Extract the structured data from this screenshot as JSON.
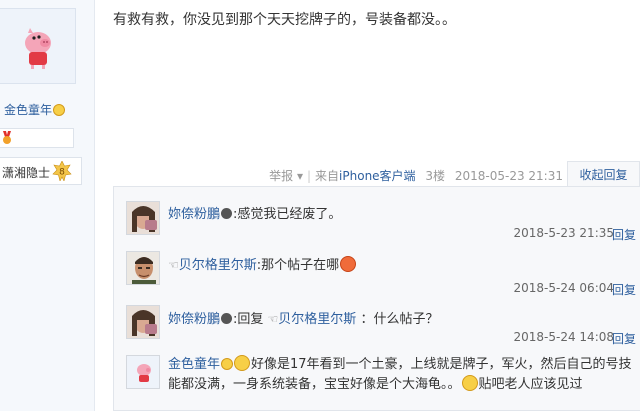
{
  "left": {
    "username": "金色童年",
    "rank_title": "潇湘隐士",
    "level": "8"
  },
  "post": {
    "text": "有救有救，你没见到那个天天挖牌子的，号装备都没。。",
    "meta": {
      "report": "举报",
      "report_arrow": "▾",
      "separator": "|",
      "client_prefix": "来自",
      "client_name": "iPhone客户端",
      "floor": "3楼",
      "datetime": "2018-05-23 21:31",
      "collapse_label": "收起回复"
    }
  },
  "replies": [
    {
      "user": "妳倷粉鵬",
      "text": ":感觉我已经废了。",
      "time": "2018-5-23 21:35",
      "reply_label": "回复"
    },
    {
      "user": "贝尔格里尔斯",
      "hand": "☜",
      "text": ":那个帖子在哪",
      "time": "2018-5-24 06:04",
      "reply_label": "回复"
    },
    {
      "user": "妳倷粉鵬",
      "text_prefix": ":回复 ",
      "quote_hand": "☜",
      "quote_user": "贝尔格里尔斯",
      "text_suffix": " ：什么帖子？",
      "time": "2018-5-24 14:08",
      "reply_label": "回复"
    },
    {
      "user": "金色童年",
      "text_line1": "好像是17年看到一个土豪，上线就是牌子，军火，然后自己的号技",
      "text_line2a": "能都没满，一身系统装备，宝宝好像是个大海龟。。",
      "text_line2b": "贴吧老人应该见过"
    }
  ],
  "colors": {
    "link": "#2e5f9e",
    "meta": "#999999",
    "reply_bg": "#f7f8fa"
  }
}
